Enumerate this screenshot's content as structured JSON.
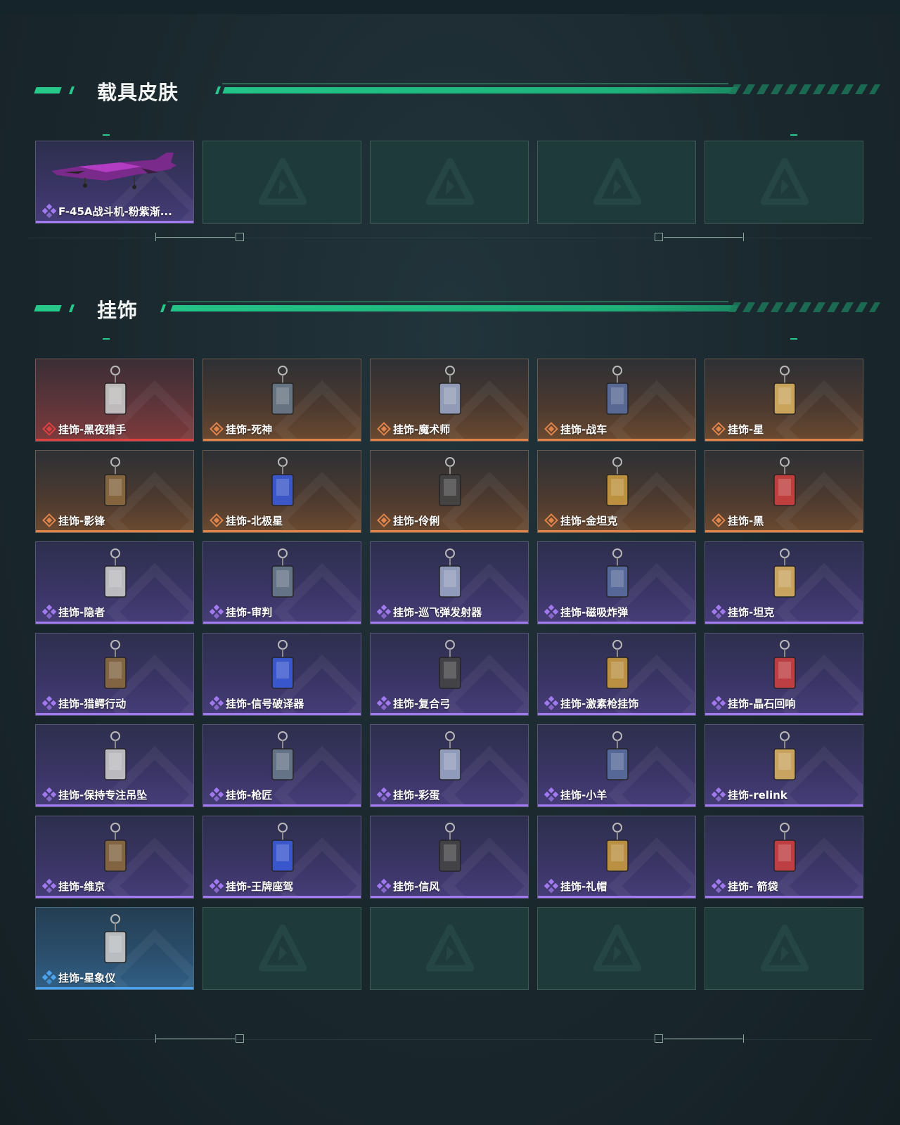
{
  "sections": {
    "vehicle_skins": {
      "title": "载具皮肤",
      "items": [
        {
          "label": "F-45A战斗机-粉紫渐...",
          "rarity": "purple",
          "icon": "fighter-jet"
        }
      ]
    },
    "charms": {
      "title": "挂饰",
      "items": [
        {
          "label": "挂饰-黑夜猎手",
          "rarity": "red"
        },
        {
          "label": "挂饰-死神",
          "rarity": "orange"
        },
        {
          "label": "挂饰-魔术师",
          "rarity": "orange"
        },
        {
          "label": "挂饰-战车",
          "rarity": "orange"
        },
        {
          "label": "挂饰-星",
          "rarity": "orange"
        },
        {
          "label": "挂饰-影锋",
          "rarity": "orange"
        },
        {
          "label": "挂饰-北极星",
          "rarity": "orange"
        },
        {
          "label": "挂饰-伶俐",
          "rarity": "orange"
        },
        {
          "label": "挂饰-金坦克",
          "rarity": "orange"
        },
        {
          "label": "挂饰-黑",
          "rarity": "orange"
        },
        {
          "label": "挂饰-隐者",
          "rarity": "purple"
        },
        {
          "label": "挂饰-审判",
          "rarity": "purple"
        },
        {
          "label": "挂饰-巡飞弹发射器",
          "rarity": "purple"
        },
        {
          "label": "挂饰-磁吸炸弹",
          "rarity": "purple"
        },
        {
          "label": "挂饰-坦克",
          "rarity": "purple"
        },
        {
          "label": "挂饰-猎鳄行动",
          "rarity": "purple"
        },
        {
          "label": "挂饰-信号破译器",
          "rarity": "purple"
        },
        {
          "label": "挂饰-复合弓",
          "rarity": "purple"
        },
        {
          "label": "挂饰-激素枪挂饰",
          "rarity": "purple"
        },
        {
          "label": "挂饰-晶石回响",
          "rarity": "purple"
        },
        {
          "label": "挂饰-保持专注吊坠",
          "rarity": "purple"
        },
        {
          "label": "挂饰-枪匠",
          "rarity": "purple"
        },
        {
          "label": "挂饰-彩蛋",
          "rarity": "purple"
        },
        {
          "label": "挂饰-小羊",
          "rarity": "purple"
        },
        {
          "label": "挂饰-relink",
          "rarity": "purple"
        },
        {
          "label": "挂饰-维京",
          "rarity": "purple"
        },
        {
          "label": "挂饰-王牌座驾",
          "rarity": "purple"
        },
        {
          "label": "挂饰-信风",
          "rarity": "purple"
        },
        {
          "label": "挂饰-礼帽",
          "rarity": "purple"
        },
        {
          "label": "挂饰- 箭袋",
          "rarity": "purple"
        },
        {
          "label": "挂饰-星象仪",
          "rarity": "blue"
        }
      ]
    }
  },
  "colors": {
    "accent": "#27c98a",
    "rarity_red": "#e04040",
    "rarity_orange": "#e0844a",
    "rarity_purple": "#a27af0",
    "rarity_blue": "#4aa4f0"
  },
  "icons": {
    "empty_slot": "game-logo-icon",
    "rarity": "rarity-diamond-icon"
  }
}
